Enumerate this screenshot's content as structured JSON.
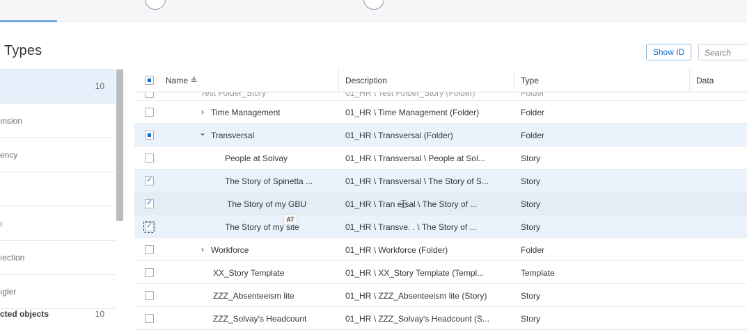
{
  "page": {
    "title": "Types",
    "show_id_label": "Show ID",
    "search_placeholder": "Search"
  },
  "left_panel": {
    "items": [
      {
        "label": "",
        "count": "10"
      },
      {
        "label": "ınsion",
        "count": ""
      },
      {
        "label": "ency",
        "count": ""
      },
      {
        "label": "",
        "count": ""
      },
      {
        "label": "ı",
        "count": ""
      },
      {
        "label": "ıection",
        "count": ""
      },
      {
        "label": "ıgler",
        "count": ""
      },
      {
        "label": "cted objects",
        "count": "10"
      }
    ]
  },
  "table": {
    "columns": {
      "name": "Name",
      "description": "Description",
      "type": "Type",
      "data": "Data"
    },
    "sort_icon": "≜",
    "partial_row": {
      "name": "Test Folder_Story",
      "description": "01_HR \\ Test Folder_Story (Folder)",
      "type": "Folder"
    },
    "rows": [
      {
        "name": "Time Management",
        "description": "01_HR \\ Time Management (Folder)",
        "type": "Folder",
        "caret": "›"
      },
      {
        "name": "Transversal",
        "description": "01_HR \\ Transversal (Folder)",
        "type": "Folder",
        "caret": "⌄"
      },
      {
        "name": "People at Solvay",
        "description": "01_HR \\ Transversal \\ People at Sol...",
        "type": "Story"
      },
      {
        "name": "The Story of Spinetta ...",
        "description": "01_HR \\ Transversal \\ The Story of S...",
        "type": "Story"
      },
      {
        "name": "The Story of my GBU",
        "description": "01_HR \\ Tran  ersal \\ The Story of ...",
        "type": "Story"
      },
      {
        "name": "The Story of my site",
        "description": "01_HR \\ Transve.   . \\ The Story of ...",
        "type": "Story"
      },
      {
        "name": "Workforce",
        "description": "01_HR \\ Workforce (Folder)",
        "type": "Folder",
        "caret": "›"
      },
      {
        "name": "XX_Story Template",
        "description": "01_HR \\ XX_Story Template (Templ...",
        "type": "Template"
      },
      {
        "name": "ZZZ_Absenteeism lite",
        "description": "01_HR \\ ZZZ_Absenteeism lite (Story)",
        "type": "Story"
      },
      {
        "name": "ZZZ_Solvay's Headcount",
        "description": "01_HR \\ ZZZ_Solvay's Headcount (S...",
        "type": "Story"
      }
    ]
  },
  "tooltip_text": "AT",
  "icons": {
    "cursor": "text-cursor-icon",
    "caret_right": "chevron-right-icon",
    "caret_down": "chevron-down-icon"
  }
}
